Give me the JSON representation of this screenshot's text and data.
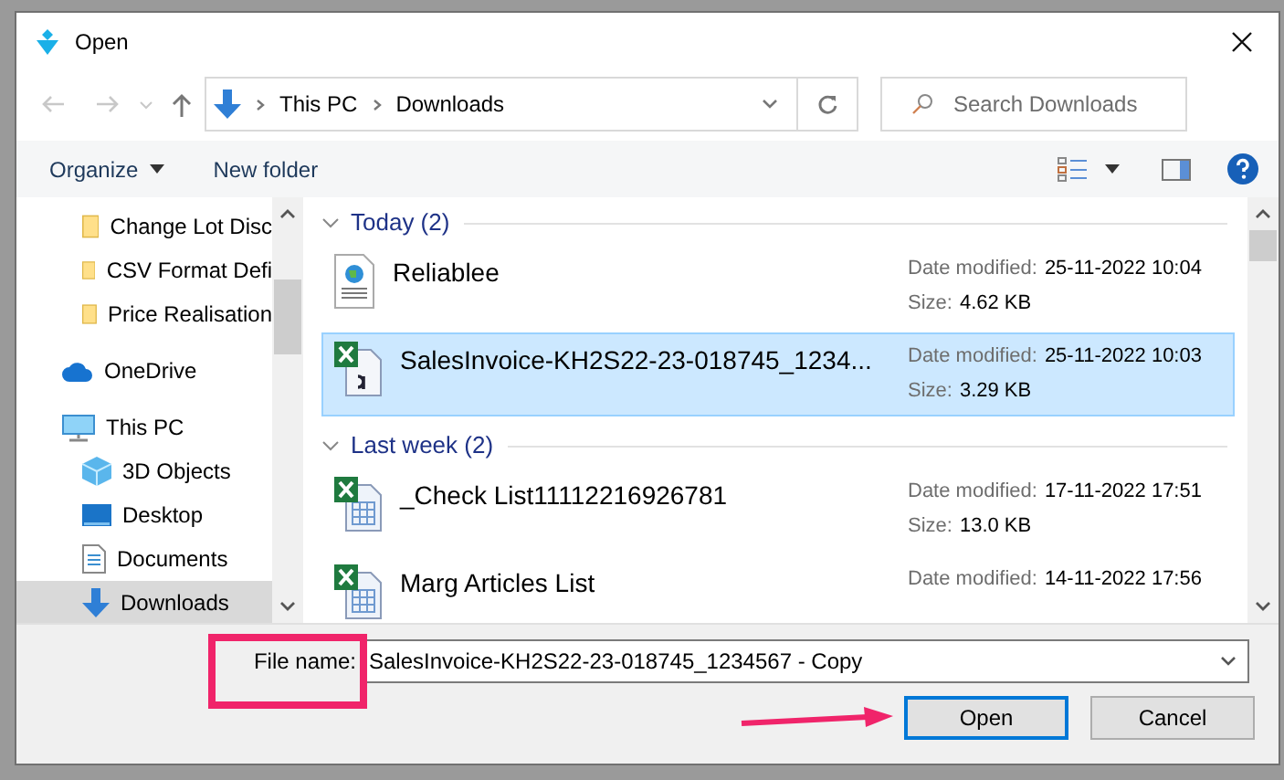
{
  "window": {
    "title": "Open"
  },
  "address_bar": {
    "crumbs": [
      "This PC",
      "Downloads"
    ]
  },
  "search": {
    "placeholder": "Search Downloads"
  },
  "toolbar": {
    "organize": "Organize",
    "new_folder": "New folder"
  },
  "quick_access_items": [
    {
      "label": "Change Lot Disc",
      "kind": "folder",
      "selected": false
    },
    {
      "label": "CSV Format Defi",
      "kind": "folder",
      "selected": false
    },
    {
      "label": "Price Realisation",
      "kind": "folder",
      "selected": false
    }
  ],
  "nav_tree": [
    {
      "label": "OneDrive",
      "kind": "cloud",
      "selected": false
    },
    {
      "label": "This PC",
      "kind": "pc",
      "selected": false,
      "children": [
        {
          "label": "3D Objects",
          "kind": "cube",
          "selected": false
        },
        {
          "label": "Desktop",
          "kind": "desktop",
          "selected": false
        },
        {
          "label": "Documents",
          "kind": "documents",
          "selected": false
        },
        {
          "label": "Downloads",
          "kind": "downloads",
          "selected": true
        }
      ]
    }
  ],
  "groups": [
    {
      "header": "Today (2)",
      "expanded": true,
      "files": [
        {
          "name": "Reliablee",
          "kind": "web",
          "selected": false,
          "date_label": "Date modified:",
          "date": "25-11-2022 10:04",
          "size_label": "Size:",
          "size": "4.62 KB"
        },
        {
          "name": "SalesInvoice-KH2S22-23-018745_1234...",
          "kind": "csv",
          "selected": true,
          "date_label": "Date modified:",
          "date": "25-11-2022 10:03",
          "size_label": "Size:",
          "size": "3.29 KB"
        }
      ]
    },
    {
      "header": "Last week (2)",
      "expanded": true,
      "files": [
        {
          "name": "_Check List11112216926781",
          "kind": "excel",
          "selected": false,
          "date_label": "Date modified:",
          "date": "17-11-2022 17:51",
          "size_label": "Size:",
          "size": "13.0 KB"
        },
        {
          "name": "Marg Articles List",
          "kind": "excel",
          "selected": false,
          "date_label": "Date modified:",
          "date": "14-11-2022 17:56"
        }
      ]
    }
  ],
  "file_name": {
    "label": "File name:",
    "value": "SalesInvoice-KH2S22-23-018745_1234567 - Copy"
  },
  "buttons": [
    {
      "label": "Open",
      "default": true
    },
    {
      "label": "Cancel",
      "default": false
    }
  ]
}
